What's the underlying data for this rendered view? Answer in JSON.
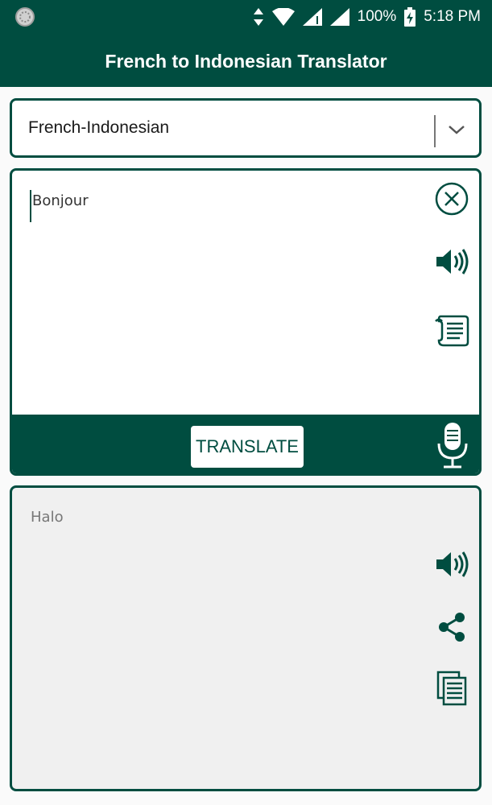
{
  "status": {
    "battery": "100%",
    "time": "5:18 PM"
  },
  "header": {
    "title": "French to Indonesian Translator"
  },
  "language_selector": {
    "selected": "French-Indonesian"
  },
  "input": {
    "text": "Bonjour"
  },
  "actions": {
    "translate_label": "TRANSLATE"
  },
  "output": {
    "text": "Halo"
  },
  "icons": {
    "clear": "close-circle-icon",
    "speak_input": "speaker-icon",
    "history": "scroll-icon",
    "mic": "microphone-icon",
    "speak_output": "speaker-icon",
    "share": "share-icon",
    "copy": "copy-icon"
  },
  "colors": {
    "primary": "#004d40",
    "output_background": "#f0f0f0"
  }
}
